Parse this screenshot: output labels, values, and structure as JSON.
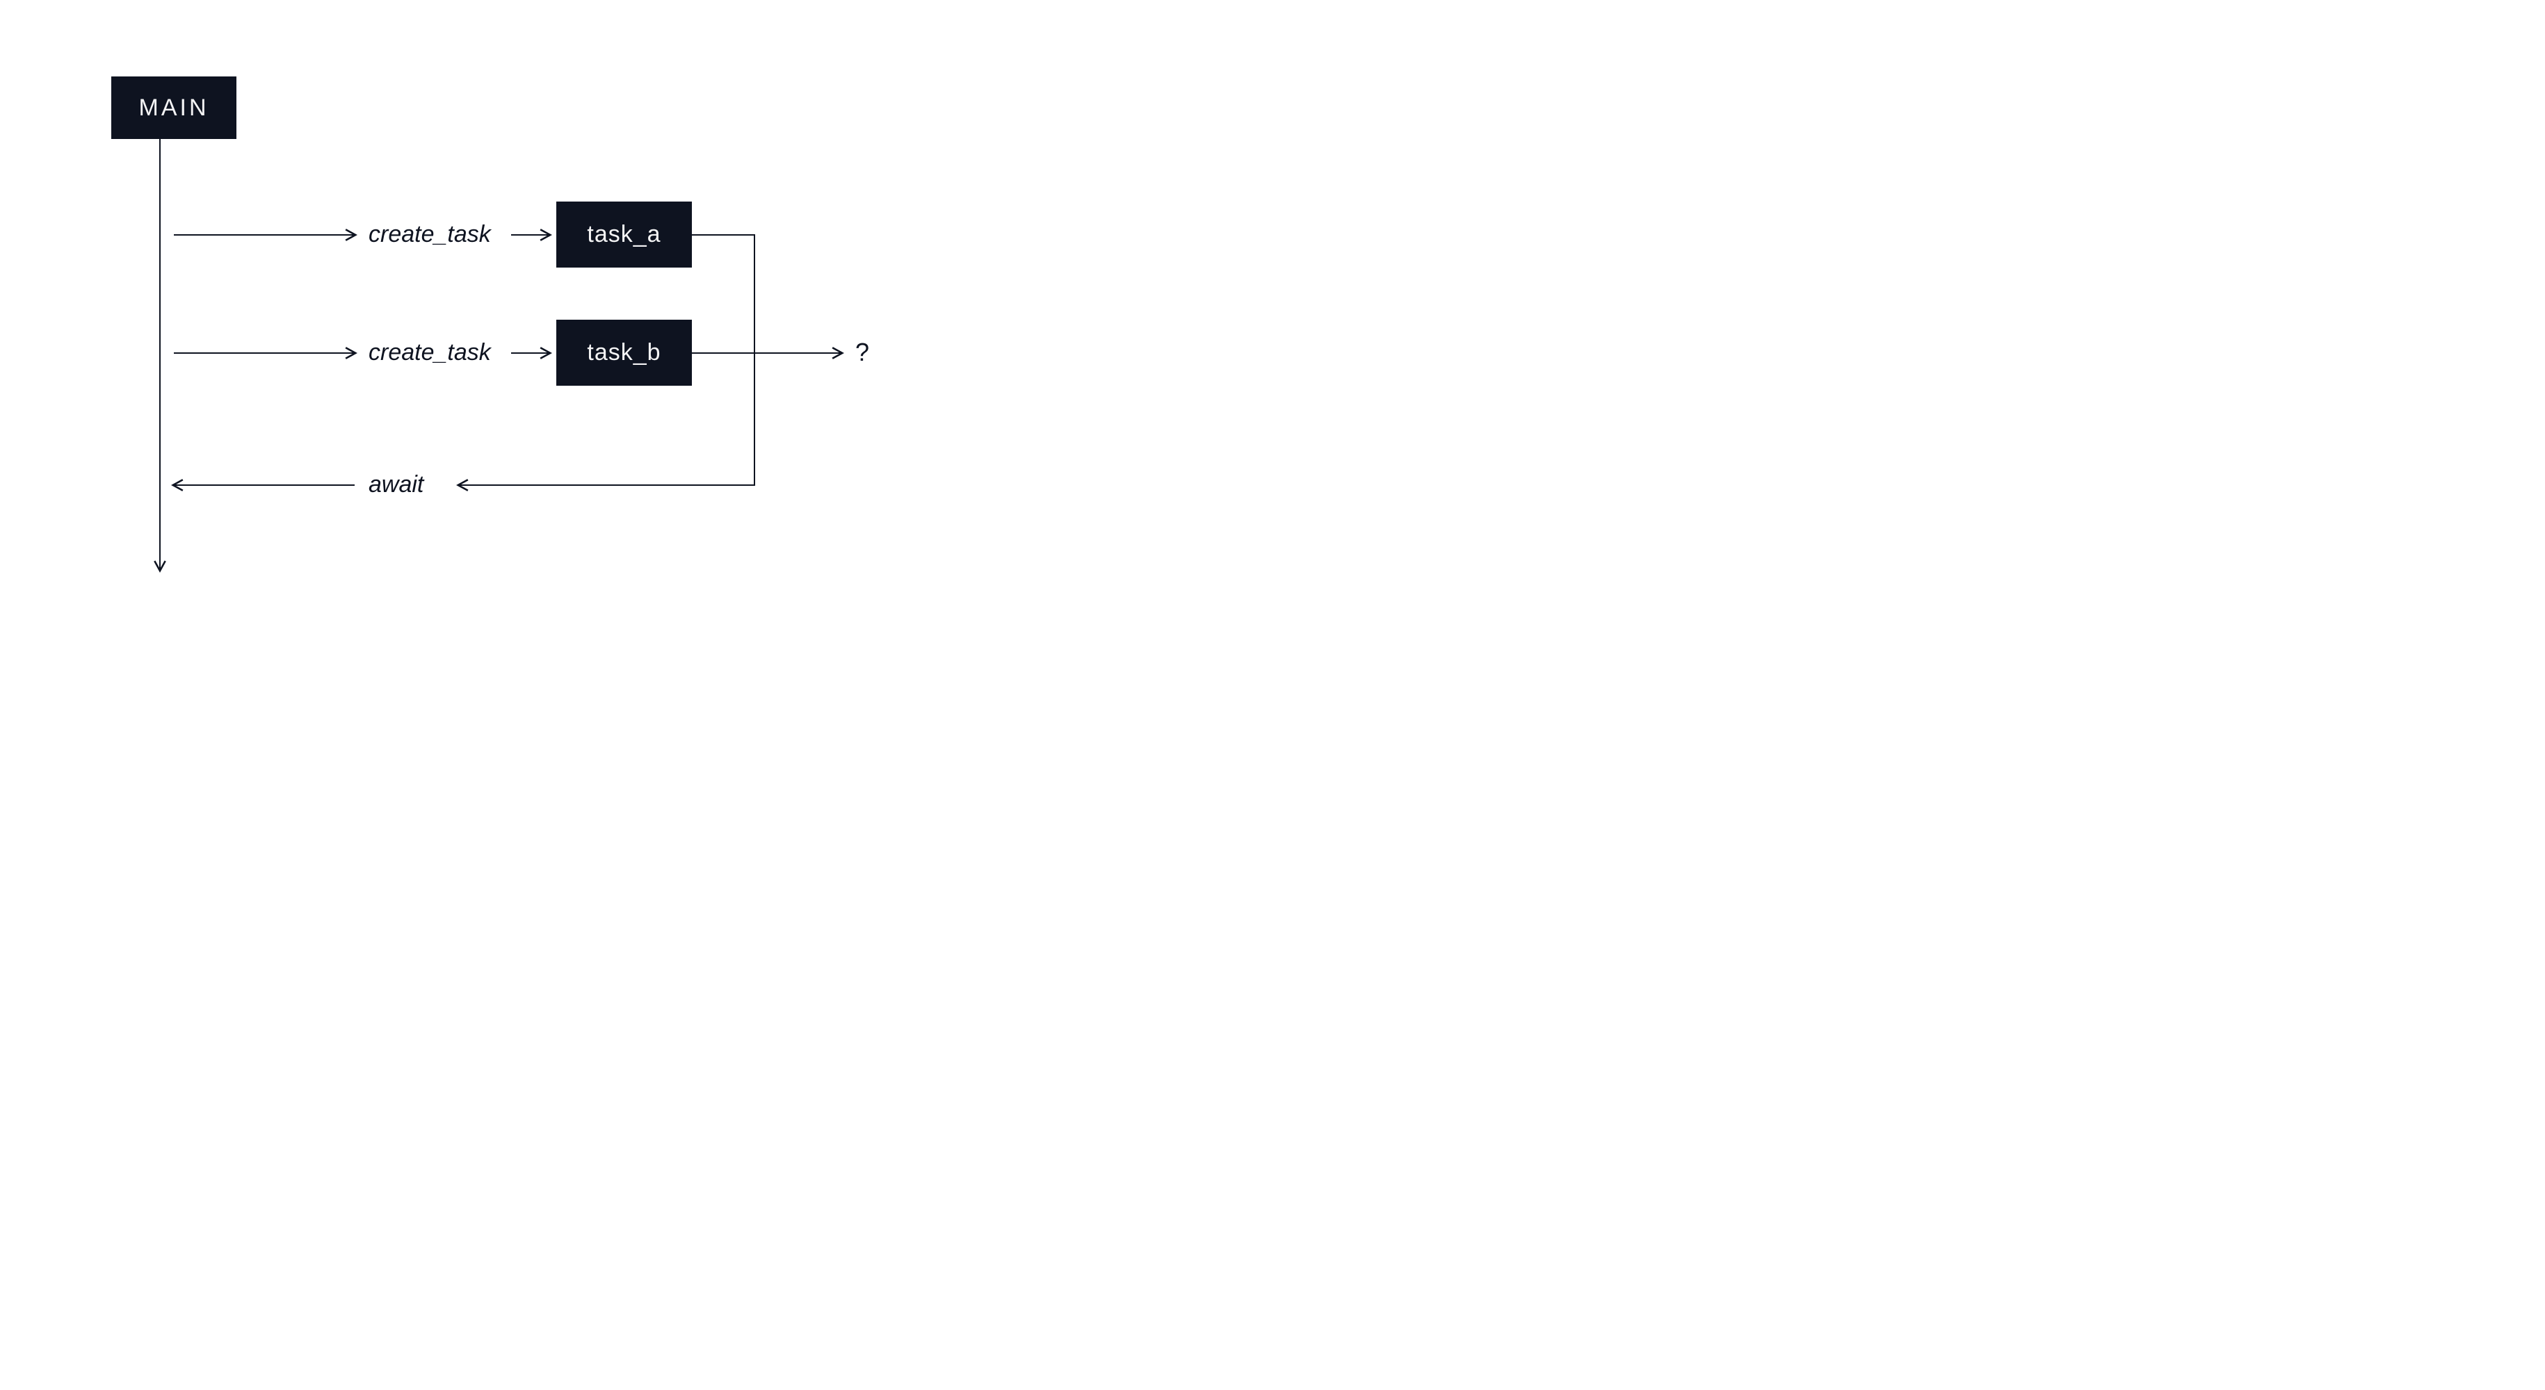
{
  "nodes": {
    "main": "MAIN",
    "task_a": "task_a",
    "task_b": "task_b"
  },
  "labels": {
    "create1": "create_task",
    "create2": "create_task",
    "await": "await",
    "question": "?"
  }
}
